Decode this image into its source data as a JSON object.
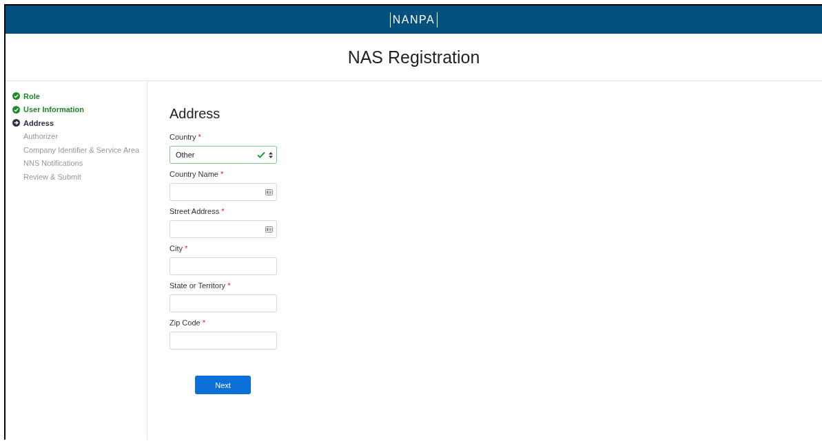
{
  "header": {
    "logo": "NANPA"
  },
  "page_title": "NAS Registration",
  "steps": [
    {
      "label": "Role",
      "kind": "done"
    },
    {
      "label": "User Information",
      "kind": "done"
    },
    {
      "label": "Address",
      "kind": "current"
    },
    {
      "label": "Authorizer",
      "kind": "pending"
    },
    {
      "label": "Company Identifier & Service Area",
      "kind": "pending"
    },
    {
      "label": "NNS Notifications",
      "kind": "pending"
    },
    {
      "label": "Review & Submit",
      "kind": "pending"
    }
  ],
  "section_title": "Address",
  "fields": [
    {
      "kind": "select",
      "label": "Country",
      "required_mark": "*",
      "value": "Other",
      "valid": true
    },
    {
      "kind": "text",
      "label": "Country Name",
      "required_mark": "*",
      "autofill_icon": true
    },
    {
      "kind": "text",
      "label": "Street Address",
      "required_mark": "*",
      "autofill_icon": true
    },
    {
      "kind": "text",
      "label": "City",
      "required_mark": "*",
      "autofill_icon": false
    },
    {
      "kind": "text",
      "label": "State or Territory",
      "required_mark": "*",
      "autofill_icon": false
    },
    {
      "kind": "text",
      "label": "Zip Code",
      "required_mark": "*",
      "autofill_icon": false
    }
  ],
  "next_button": "Next"
}
